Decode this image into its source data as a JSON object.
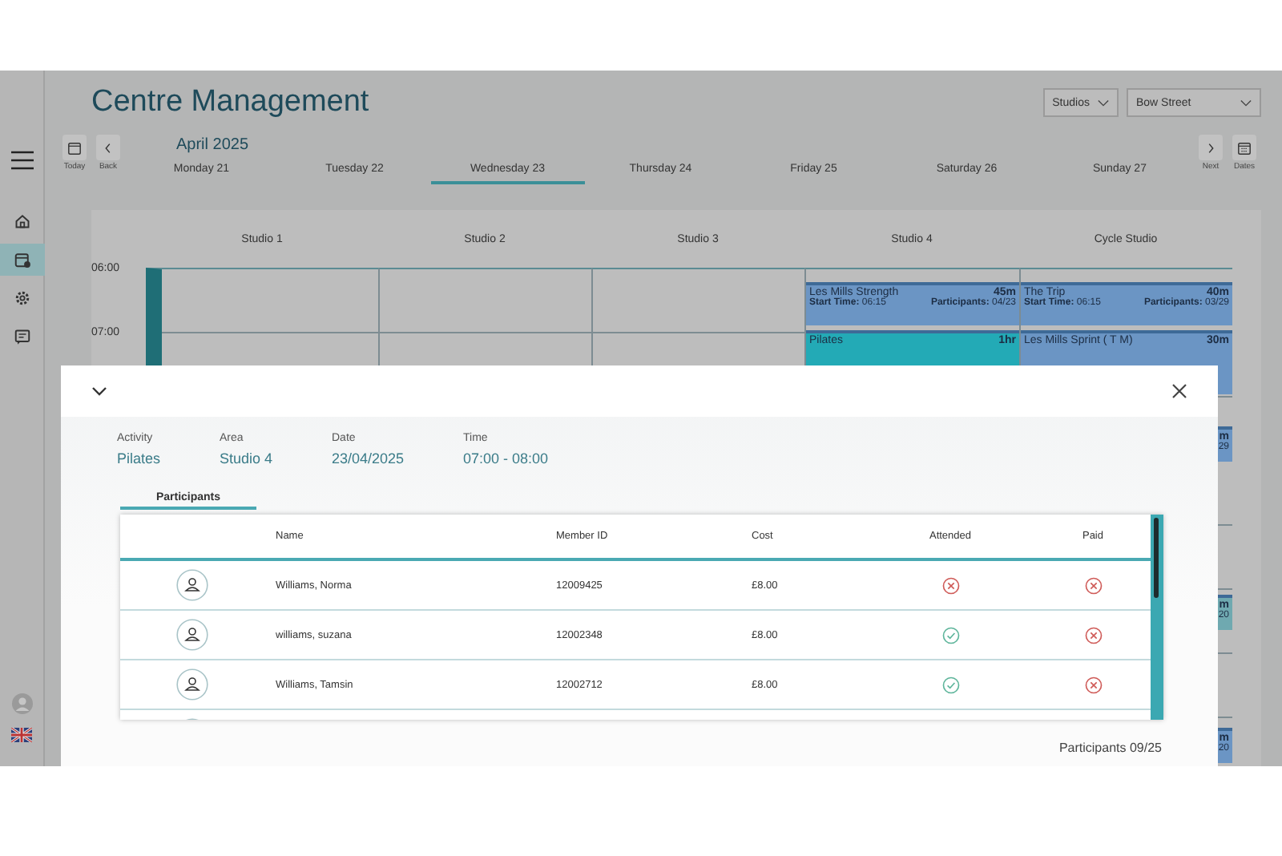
{
  "header": {
    "title": "Centre Management",
    "filters": [
      {
        "label": "Studios"
      },
      {
        "label": "Bow Street"
      }
    ]
  },
  "sidebar": {
    "items": [
      {
        "kind": "home",
        "selected": false
      },
      {
        "kind": "calendar",
        "selected": true
      },
      {
        "kind": "settings",
        "selected": false
      },
      {
        "kind": "messages",
        "selected": false
      }
    ]
  },
  "date_nav": {
    "today_label": "Today",
    "back_label": "Back",
    "next_label": "Next",
    "dates_label": "Dates",
    "month": "April 2025",
    "days": [
      {
        "label": "Monday 21",
        "selected": false
      },
      {
        "label": "Tuesday 22",
        "selected": false
      },
      {
        "label": "Wednesday 23",
        "selected": true
      },
      {
        "label": "Thursday 24",
        "selected": false
      },
      {
        "label": "Friday 25",
        "selected": false
      },
      {
        "label": "Saturday 26",
        "selected": false
      },
      {
        "label": "Sunday 27",
        "selected": false
      }
    ]
  },
  "schedule": {
    "times": [
      "06:00",
      "07:00"
    ],
    "columns": [
      {
        "name": "Studio 1"
      },
      {
        "name": "Studio 2"
      },
      {
        "name": "Studio 3"
      },
      {
        "name": "Studio 4",
        "events": [
          {
            "kind": "full",
            "title": "Les Mills Strength",
            "duration": "45m",
            "start_label": "Start Time:",
            "start": "06:15",
            "participants_label": "Participants:",
            "participants": "04/23",
            "color": "#6b95c4"
          },
          {
            "kind": "partial",
            "title": "Pilates",
            "duration": "1hr",
            "color": "#23aab6"
          }
        ]
      },
      {
        "name": "Cycle Studio",
        "events": [
          {
            "kind": "full",
            "title": "The Trip",
            "duration": "40m",
            "start_label": "Start Time:",
            "start": "06:15",
            "participants_label": "Participants:",
            "participants": "03/29",
            "color": "#6b95c4"
          },
          {
            "kind": "partial",
            "title": "Les Mills Sprint ( T M)",
            "duration": "30m",
            "color": "#6b95c4"
          },
          {
            "kind": "fragment",
            "duration": "m",
            "participants": "29",
            "color": "#6b95c4"
          },
          {
            "kind": "fragment",
            "duration": "m",
            "participants": "20",
            "color": "#6fa9b0"
          },
          {
            "kind": "fragment",
            "duration": "m",
            "participants": "20",
            "color": "#6b95c4"
          }
        ]
      }
    ]
  },
  "modal": {
    "details": [
      {
        "label": "Activity",
        "value": "Pilates"
      },
      {
        "label": "Area",
        "value": "Studio 4"
      },
      {
        "label": "Date",
        "value": "23/04/2025"
      },
      {
        "label": "Time",
        "value": "07:00 - 08:00"
      }
    ],
    "tabs": [
      {
        "label": "Participants",
        "selected": true
      }
    ],
    "table": {
      "columns": [
        "Name",
        "Member ID",
        "Cost",
        "Attended",
        "Paid"
      ],
      "rows": [
        {
          "name": "Williams, Norma",
          "member_id": "12009425",
          "cost": "£8.00",
          "attended": false,
          "paid": false
        },
        {
          "name": "williams, suzana",
          "member_id": "12002348",
          "cost": "£8.00",
          "attended": true,
          "paid": false
        },
        {
          "name": "Williams, Tamsin",
          "member_id": "12002712",
          "cost": "£8.00",
          "attended": true,
          "paid": false
        }
      ]
    },
    "footer": "Participants 09/25"
  }
}
